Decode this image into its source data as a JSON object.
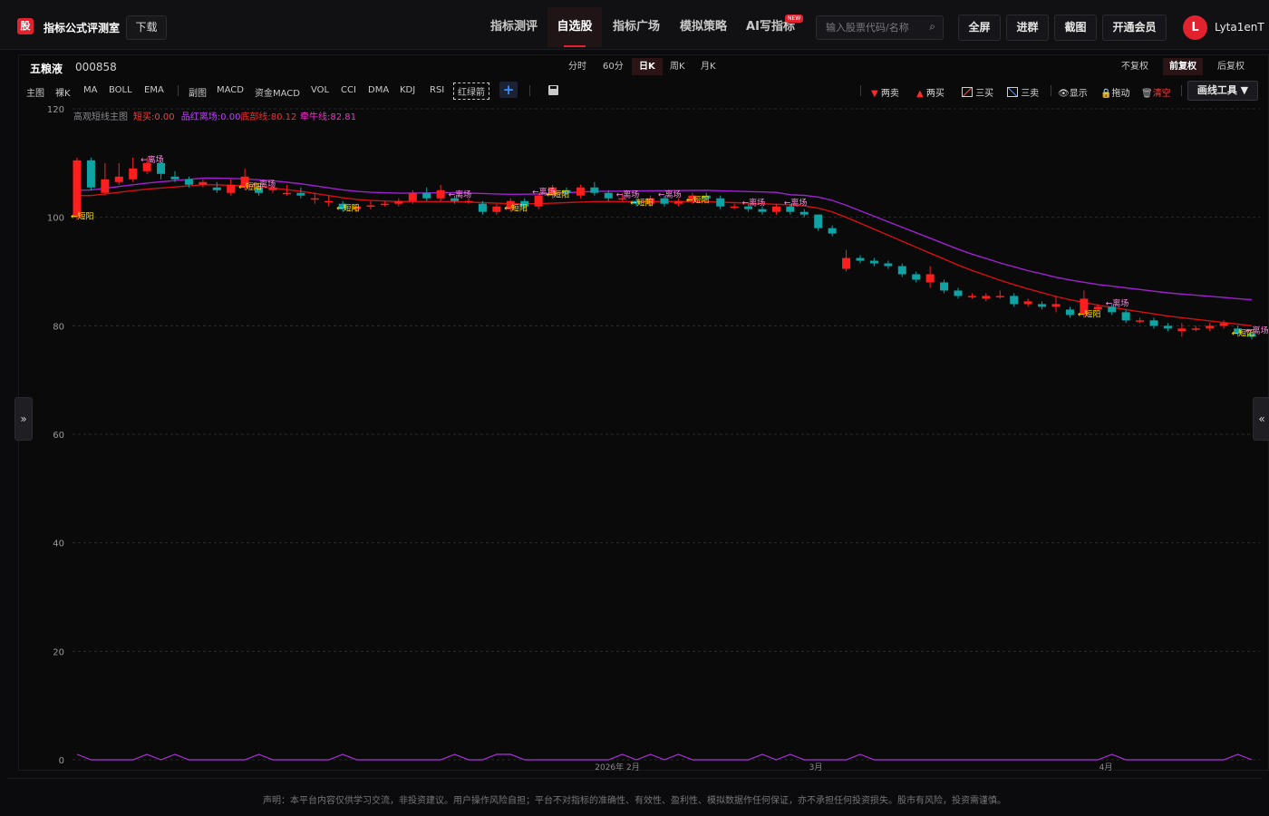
{
  "header": {
    "logo_text": "股",
    "brand": "指标公式评测室",
    "download": "下载",
    "nav": [
      {
        "label": "指标测评",
        "active": false
      },
      {
        "label": "自选股",
        "active": true
      },
      {
        "label": "指标广场",
        "active": false
      },
      {
        "label": "模拟策略",
        "active": false
      },
      {
        "label": "AI写指标",
        "active": false
      }
    ],
    "new_badge": "NEW",
    "search_placeholder": "输入股票代码/名称",
    "buttons": [
      "全屏",
      "进群",
      "截图",
      "开通会员"
    ],
    "avatar_letter": "L",
    "username": "Lyta1enT"
  },
  "stock": {
    "name": "五粮液",
    "code": "000858"
  },
  "periods": [
    {
      "label": "分时",
      "active": false
    },
    {
      "label": "60分",
      "active": false
    },
    {
      "label": "日K",
      "active": true
    },
    {
      "label": "周K",
      "active": false
    },
    {
      "label": "月K",
      "active": false
    }
  ],
  "adjust": [
    {
      "label": "不复权",
      "active": false
    },
    {
      "label": "前复权",
      "active": true
    },
    {
      "label": "后复权",
      "active": false
    }
  ],
  "indicators_main": [
    "主图",
    "裸K",
    "MA",
    "BOLL",
    "EMA"
  ],
  "indicators_sub": [
    "副图",
    "MACD",
    "资金MACD",
    "VOL",
    "CCI",
    "DMA",
    "KDJ",
    "RSI"
  ],
  "indicator_boxed": "红绿箭",
  "right_tools": [
    "两卖",
    "两买",
    "三买",
    "三卖",
    "显示",
    "拖动",
    "清空"
  ],
  "draw_tool": "画线工具 ▼",
  "legend": {
    "name": "高观短线主图",
    "items": [
      {
        "text": "短买:0.00",
        "color": "#ff3b3b"
      },
      {
        "text": "品红离场:0.00",
        "color": "#c040ff"
      },
      {
        "text": "底部线:80.12",
        "color": "#ff2a2a"
      },
      {
        "text": "牵牛线:82.81",
        "color": "#ff2ad4"
      }
    ]
  },
  "signal_labels": {
    "buy": "短阳",
    "exit": "离场"
  },
  "disclaimer": "声明：本平台内容仅供学习交流，非投资建议。用户操作风险自担；平台不对指标的准确性、有效性、盈利性、模拟数据作任何保证，亦不承担任何投资损失。股市有风险，投资需谨慎。",
  "side_left": "»",
  "side_right": "«",
  "colors": {
    "up": "#ff1e1e",
    "down": "#0fa3a3",
    "ma_red": "#d21010",
    "ma_purple": "#a020d0",
    "accent": "#e2232f"
  },
  "chart_data": {
    "type": "candlestick",
    "ylim": [
      0,
      120
    ],
    "y_ticks": [
      0,
      20,
      40,
      60,
      80,
      100,
      120
    ],
    "x_ticks": [
      "2026年 2月",
      "3月",
      "4月"
    ],
    "candles": [
      [
        100,
        110.5,
        111,
        99.5
      ],
      [
        110.5,
        105.5,
        111,
        105
      ],
      [
        104.5,
        107,
        110,
        104
      ],
      [
        106.5,
        107.5,
        110,
        106
      ],
      [
        107,
        109,
        111,
        106.5
      ],
      [
        108.5,
        110,
        111,
        108
      ],
      [
        110,
        108,
        110.5,
        107
      ],
      [
        107.5,
        107,
        108.5,
        106.5
      ],
      [
        107,
        106,
        107.5,
        105.5
      ],
      [
        106,
        106.5,
        107,
        105.5
      ],
      [
        105.5,
        105,
        106.5,
        104.5
      ],
      [
        104.5,
        106,
        107,
        104
      ],
      [
        105.5,
        107.5,
        109,
        105
      ],
      [
        105.5,
        104.5,
        106,
        104
      ],
      [
        105,
        105.5,
        106,
        104.5
      ],
      [
        104.5,
        104.5,
        106,
        104
      ],
      [
        104.5,
        104,
        105.5,
        103.5
      ],
      [
        103.5,
        103.5,
        104.5,
        102.5
      ],
      [
        103,
        103,
        104,
        102
      ],
      [
        102.5,
        101.5,
        103,
        101
      ],
      [
        101.5,
        102,
        102.5,
        101
      ],
      [
        102,
        102.2,
        103,
        101.5
      ],
      [
        102.5,
        102.5,
        103,
        102
      ],
      [
        102.5,
        103,
        103.5,
        102
      ],
      [
        103,
        104.5,
        105,
        102.5
      ],
      [
        104.5,
        103.5,
        105.5,
        103
      ],
      [
        103.5,
        105,
        106,
        103
      ],
      [
        103.5,
        103,
        104,
        102.5
      ],
      [
        103,
        103,
        103.5,
        102.5
      ],
      [
        102.5,
        101,
        103,
        100.5
      ],
      [
        101,
        102,
        102.5,
        100.5
      ],
      [
        101.5,
        103,
        103.5,
        101
      ],
      [
        103,
        102,
        103.5,
        101.5
      ],
      [
        102,
        104,
        104.5,
        101.5
      ],
      [
        104,
        105.5,
        106,
        103.5
      ],
      [
        105,
        104.5,
        105.5,
        104
      ],
      [
        104,
        105.5,
        106,
        103.5
      ],
      [
        105.5,
        104.5,
        106.5,
        104
      ],
      [
        104.5,
        103.5,
        105,
        103
      ],
      [
        103.5,
        103.5,
        104.5,
        103
      ],
      [
        103,
        102.5,
        103.5,
        102
      ],
      [
        102.5,
        103.5,
        104,
        102
      ],
      [
        103.5,
        102.5,
        104,
        102
      ],
      [
        102.5,
        103,
        103.5,
        102
      ],
      [
        103,
        104,
        104.5,
        102.5
      ],
      [
        104,
        103.5,
        104.5,
        103
      ],
      [
        103.5,
        102,
        104,
        101.5
      ],
      [
        102,
        102,
        102.5,
        101.5
      ],
      [
        102,
        101.5,
        102.5,
        101
      ],
      [
        101.5,
        101,
        102,
        100.5
      ],
      [
        101,
        102,
        102.5,
        100.5
      ],
      [
        102,
        101,
        102.5,
        100.5
      ],
      [
        101,
        100.5,
        101.5,
        100
      ],
      [
        100.5,
        98,
        100.5,
        97.5
      ],
      [
        98,
        97,
        98.5,
        96.5
      ],
      [
        90.5,
        92.5,
        94,
        90
      ],
      [
        92.5,
        92,
        93,
        91.5
      ],
      [
        92,
        91.5,
        92.5,
        91
      ],
      [
        91.5,
        91,
        92,
        90.5
      ],
      [
        91,
        89.5,
        91.5,
        89
      ],
      [
        89.5,
        88.5,
        90,
        88
      ],
      [
        88,
        89.5,
        91,
        87
      ],
      [
        88,
        86.5,
        88.5,
        86
      ],
      [
        86.5,
        85.5,
        87,
        85
      ],
      [
        85.5,
        85.5,
        86,
        85
      ],
      [
        85,
        85.5,
        86,
        84.5
      ],
      [
        85.5,
        85.5,
        86.5,
        85
      ],
      [
        85.5,
        84,
        86,
        83.5
      ],
      [
        84,
        84.5,
        85,
        83.5
      ],
      [
        84,
        83.5,
        84.5,
        83
      ],
      [
        83.5,
        84,
        85.5,
        82.5
      ],
      [
        83,
        82,
        83.5,
        81.5
      ],
      [
        82,
        85,
        86.5,
        81.5
      ],
      [
        83,
        83.5,
        84,
        82.5
      ],
      [
        83.5,
        82.5,
        84,
        82
      ],
      [
        82.5,
        81,
        83,
        80.5
      ],
      [
        81,
        81,
        81.5,
        80.5
      ],
      [
        81,
        80,
        81.5,
        79.5
      ],
      [
        80,
        79.5,
        80.5,
        79
      ],
      [
        79,
        79.5,
        80.5,
        78
      ],
      [
        79.5,
        79.5,
        80,
        79
      ],
      [
        79.5,
        80,
        80.5,
        79
      ],
      [
        80,
        80.5,
        81,
        79.5
      ],
      [
        79.5,
        78.5,
        80,
        78
      ],
      [
        78.5,
        78,
        79,
        77.5
      ]
    ],
    "ma_red": [
      104,
      104,
      104.3,
      104.6,
      104.9,
      105.2,
      105.4,
      105.6,
      105.8,
      106,
      106,
      105.9,
      105.8,
      105.6,
      105.4,
      105.1,
      104.8,
      104.4,
      104,
      103.6,
      103.3,
      103.1,
      103,
      102.9,
      102.9,
      102.9,
      102.9,
      102.9,
      102.8,
      102.7,
      102.6,
      102.5,
      102.5,
      102.5,
      102.6,
      102.7,
      102.8,
      102.9,
      102.9,
      102.9,
      102.9,
      102.9,
      102.9,
      102.9,
      102.9,
      102.9,
      102.8,
      102.7,
      102.6,
      102.5,
      102.4,
      102.3,
      102.1,
      101.7,
      101,
      100,
      98.9,
      97.8,
      96.7,
      95.6,
      94.5,
      93.4,
      92.3,
      91.2,
      90.2,
      89.3,
      88.4,
      87.6,
      86.8,
      86.1,
      85.4,
      84.8,
      84.3,
      83.8,
      83.4,
      83,
      82.6,
      82.2,
      81.8,
      81.5,
      81.2,
      80.9,
      80.6,
      80.3,
      80
    ]
  }
}
